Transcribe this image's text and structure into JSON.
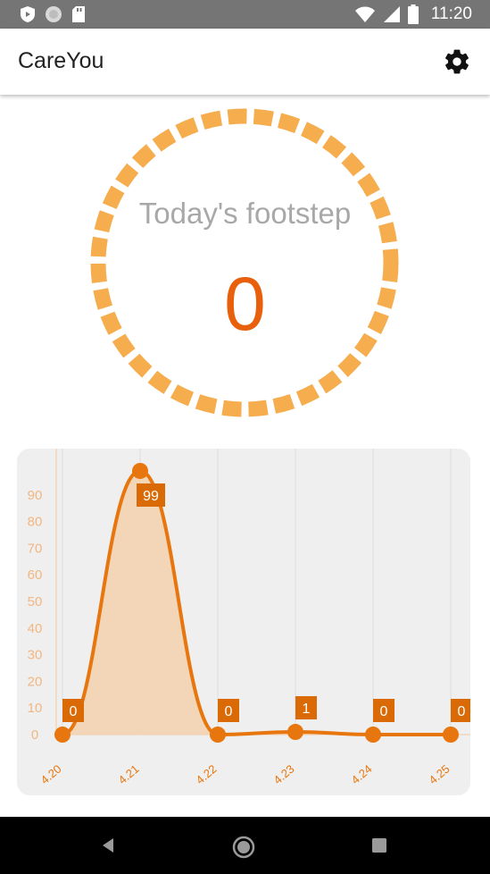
{
  "status_bar": {
    "time": "11:20",
    "icons": [
      "shield-icon",
      "circle-status-icon",
      "sd-card-icon",
      "wifi-icon",
      "signal-icon",
      "battery-icon"
    ]
  },
  "app_bar": {
    "title": "CareYou",
    "settings_icon": "gear-icon"
  },
  "footstep": {
    "label": "Today's footstep",
    "value": "0",
    "ring_color": "#f5ad4e",
    "value_color": "#e8600b"
  },
  "chart_data": {
    "type": "area",
    "x": [
      "4.20",
      "4.21",
      "4.22",
      "4.23",
      "4.24",
      "4.25"
    ],
    "series": [
      {
        "values": [
          0,
          99,
          0,
          1,
          0,
          0
        ]
      }
    ],
    "data_labels": [
      "0",
      "99",
      "0",
      "1",
      "0",
      "0"
    ],
    "y_ticks": [
      "0",
      "10",
      "20",
      "30",
      "40",
      "50",
      "60",
      "70",
      "80",
      "90"
    ],
    "ylim": [
      0,
      100
    ],
    "grid": true,
    "colors": {
      "line": "#e8760e",
      "fill": "#f2d3b0",
      "label_bg": "#d96a06",
      "tick": "#f2b680"
    }
  },
  "nav_bar": {
    "back_icon": "back-triangle-icon",
    "home_icon": "home-circle-icon",
    "recents_icon": "recents-square-icon"
  }
}
